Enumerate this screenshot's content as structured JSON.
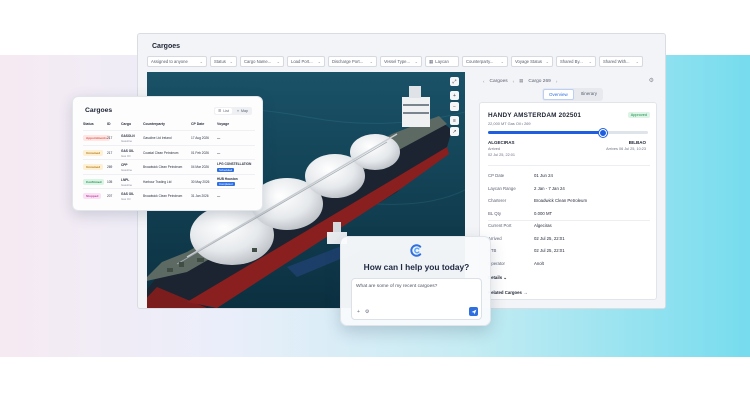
{
  "app": {
    "title": "Cargoes"
  },
  "filters": [
    {
      "label": "Assigned to anyone",
      "w": 60
    },
    {
      "label": "Status",
      "w": 27
    },
    {
      "label": "Cargo Name...",
      "w": 44
    },
    {
      "label": "Load Port...",
      "w": 38
    },
    {
      "label": "Discharge Port...",
      "w": 49
    },
    {
      "label": "Vessel Type...",
      "w": 42
    },
    {
      "label": "Laycan",
      "w": 34,
      "calendar": true
    },
    {
      "label": "Counterparty...",
      "w": 46
    },
    {
      "label": "Voyage Status",
      "w": 42
    },
    {
      "label": "Shared By...",
      "w": 40
    },
    {
      "label": "Shared With...",
      "w": 44
    }
  ],
  "detail": {
    "breadcrumb_parent": "Cargoes",
    "breadcrumb_current": "Cargo 269",
    "tabs": [
      "Overview",
      "Itinerary"
    ],
    "active_tab": "Overview",
    "ship_name": "HANDY AMSTERDAM 202501",
    "ship_sub": "22,000 MT Gas Oil • 269",
    "badge": "Approved",
    "progress": 0.72,
    "load_port": "ALGECIRAS",
    "load_status": "Arrived",
    "load_date": "02 Jul 25, 22:01",
    "discharge_port": "BILBAO",
    "discharge_eta": "Arrives 06 Jul 25, 10:23",
    "fields": [
      {
        "k": "CP Date",
        "v": "01 Jun 24"
      },
      {
        "k": "Laycan Range",
        "v": "2 Jan - 7 Jan 24"
      },
      {
        "k": "Charterer",
        "v": "Broadwick Clean Petroleum"
      },
      {
        "k": "BL Qty",
        "v": "0.000 MT"
      },
      {
        "k": "Current Port",
        "v": "Algeciras"
      },
      {
        "k": "Arrived",
        "v": "02 Jul 25, 22:01"
      },
      {
        "k": "ETB",
        "v": "02 Jul 25, 22:01"
      },
      {
        "k": "Operator",
        "v": "Anolt"
      }
    ],
    "more_details": "Details",
    "related": "Related Cargoes"
  },
  "cargo_table": {
    "title": "Cargoes",
    "views": [
      "List",
      "Map"
    ],
    "headers": [
      "Status",
      "ID",
      "Cargo",
      "Counterparty",
      "CP Date",
      "Voyage"
    ],
    "rows": [
      {
        "status": "Appointments",
        "status_color": "#e0584d",
        "status_bg": "#fde6e4",
        "id": "217",
        "cargo": "GASOLN",
        "cargo_sub": "Gasoline",
        "counterparty": "Gasoline Ltd Ireland",
        "cp": "17 Aug 2026",
        "voyage": "—"
      },
      {
        "status": "Unnamed",
        "status_color": "#b67b12",
        "status_bg": "#fdf0d5",
        "id": "217",
        "cargo": "GAS OIL",
        "cargo_sub": "Gas Oil",
        "counterparty": "Coastal Clean Petroleum",
        "cp": "01 Feb 2026",
        "voyage": "—"
      },
      {
        "status": "Unnamed",
        "status_color": "#b67b12",
        "status_bg": "#fdf0d5",
        "id": "269",
        "cargo": "CPP",
        "cargo_sub": "Gasoline",
        "counterparty": "Broadwick Clean Petroleum",
        "cp": "04 Mar 2026",
        "voyage": "LPG CONSTELLATION",
        "voyage_sub": "Scheduled"
      },
      {
        "status": "Confirmed",
        "status_color": "#1c8f4e",
        "status_bg": "#dbf4e5",
        "id": "105",
        "cargo": "LNPL",
        "cargo_sub": "Gasoline",
        "counterparty": "Harbour Trading Ltd",
        "cp": "30 May 2026",
        "voyage": "HUB Houston",
        "voyage_sub": "Completed"
      },
      {
        "status": "Stopped",
        "status_color": "#c03aa0",
        "status_bg": "#f9e1f3",
        "id": "207",
        "cargo": "GAS OIL",
        "cargo_sub": "Gas Oil",
        "counterparty": "Broadwick Clean Petroleum",
        "cp": "31 Jan 2026",
        "voyage": "—"
      }
    ]
  },
  "chat": {
    "question": "How can I help you today?",
    "input": "What are some of my recent cargoes?"
  }
}
